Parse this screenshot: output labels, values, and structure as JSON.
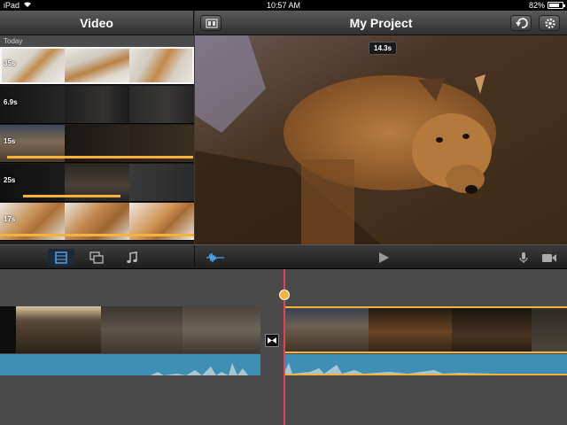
{
  "status_bar": {
    "device": "iPad",
    "time": "10:57 AM",
    "battery": "82%",
    "battery_level": 0.82
  },
  "browser": {
    "title": "Video",
    "section": "Today",
    "clips": [
      {
        "duration": "35s",
        "selected": true
      },
      {
        "duration": "6.9s"
      },
      {
        "duration": "15s"
      },
      {
        "duration": "25s"
      },
      {
        "duration": "17s"
      }
    ]
  },
  "viewer": {
    "title": "My Project",
    "time_badge": "14.3s"
  },
  "toolbar": {
    "tabs": [
      "film-strip-icon",
      "photos-icon",
      "music-note-icon"
    ],
    "icons": [
      "audio-waveform-icon",
      "play-icon",
      "microphone-icon",
      "video-camera-icon"
    ]
  },
  "colors": {
    "accent_orange": "#f5b33c",
    "playhead_red": "#e8405a",
    "audio_blue": "#3f8fb5"
  }
}
